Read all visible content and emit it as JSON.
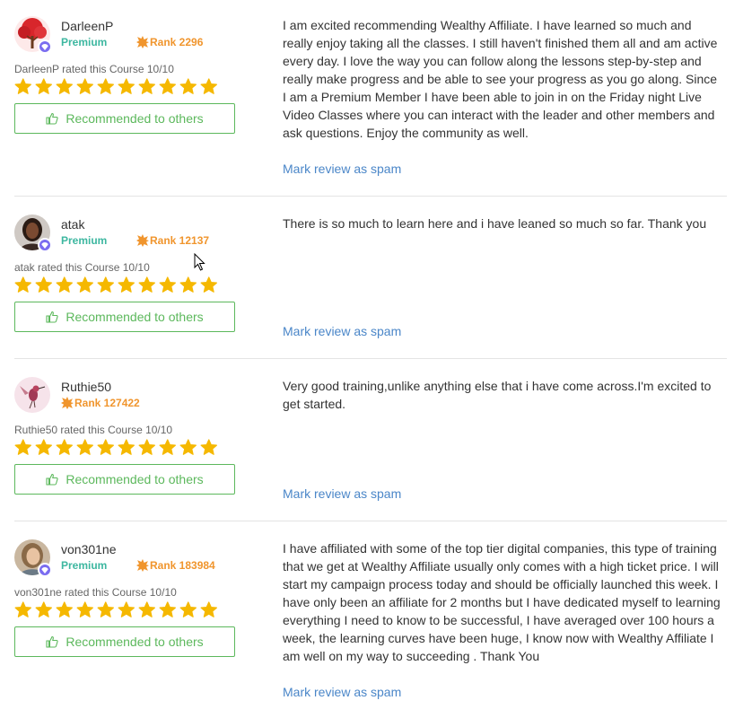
{
  "colors": {
    "premium": "#3db7a0",
    "rank": "#f0952d",
    "star": "#f5b800",
    "recommend": "#5cb85c",
    "link": "#4a86c8"
  },
  "icons": {
    "star": "star-icon",
    "rank": "sun-icon",
    "recommend": "thumbs-up-icon",
    "premium_badge": "diamond-icon"
  },
  "reviews": [
    {
      "username": "DarleenP",
      "membership": "Premium",
      "rank": "Rank 2296",
      "rated": "DarleenP rated this Course 10/10",
      "rating": 10,
      "recommend_label": "Recommended to others",
      "text": "I am excited recommending Wealthy Affiliate. I have learned so much and really enjoy taking all the classes. I still haven't finished them all and am active every day. I love the way you can follow along the lessons step-by-step and really make progress and be able to see your progress as you go along. Since I am a Premium Member I have been able to join in on the Friday night Live Video Classes where you can interact with the leader and other members and ask questions. Enjoy the community as well.",
      "spam_label": "Mark review as spam"
    },
    {
      "username": "atak",
      "membership": "Premium",
      "rank": "Rank 12137",
      "rated": "atak rated this Course 10/10",
      "rating": 10,
      "recommend_label": "Recommended to others",
      "text": "There is so much to learn here and i have leaned so much so far. Thank you",
      "spam_label": "Mark review as spam"
    },
    {
      "username": "Ruthie50",
      "membership": "",
      "rank": "Rank 127422",
      "rated": "Ruthie50 rated this Course 10/10",
      "rating": 10,
      "recommend_label": "Recommended to others",
      "text": "Very good training,unlike anything else that i have come across.I'm excited to get started.",
      "spam_label": "Mark review as spam"
    },
    {
      "username": "von301ne",
      "membership": "Premium",
      "rank": "Rank 183984",
      "rated": "von301ne rated this Course 10/10",
      "rating": 10,
      "recommend_label": "Recommended to others",
      "text": "I have affiliated with some of the top tier digital companies, this type of training that we get at Wealthy Affiliate usually only comes with a high ticket price. I will start my campaign process today and should be officially launched this week. I have only been an affiliate for 2 months but I have dedicated myself to learning everything I need to know to be successful, I have averaged over 100 hours a week, the learning curves have been huge, I know now with Wealthy Affiliate I am well on my way to succeeding . Thank You",
      "spam_label": "Mark review as spam"
    }
  ]
}
